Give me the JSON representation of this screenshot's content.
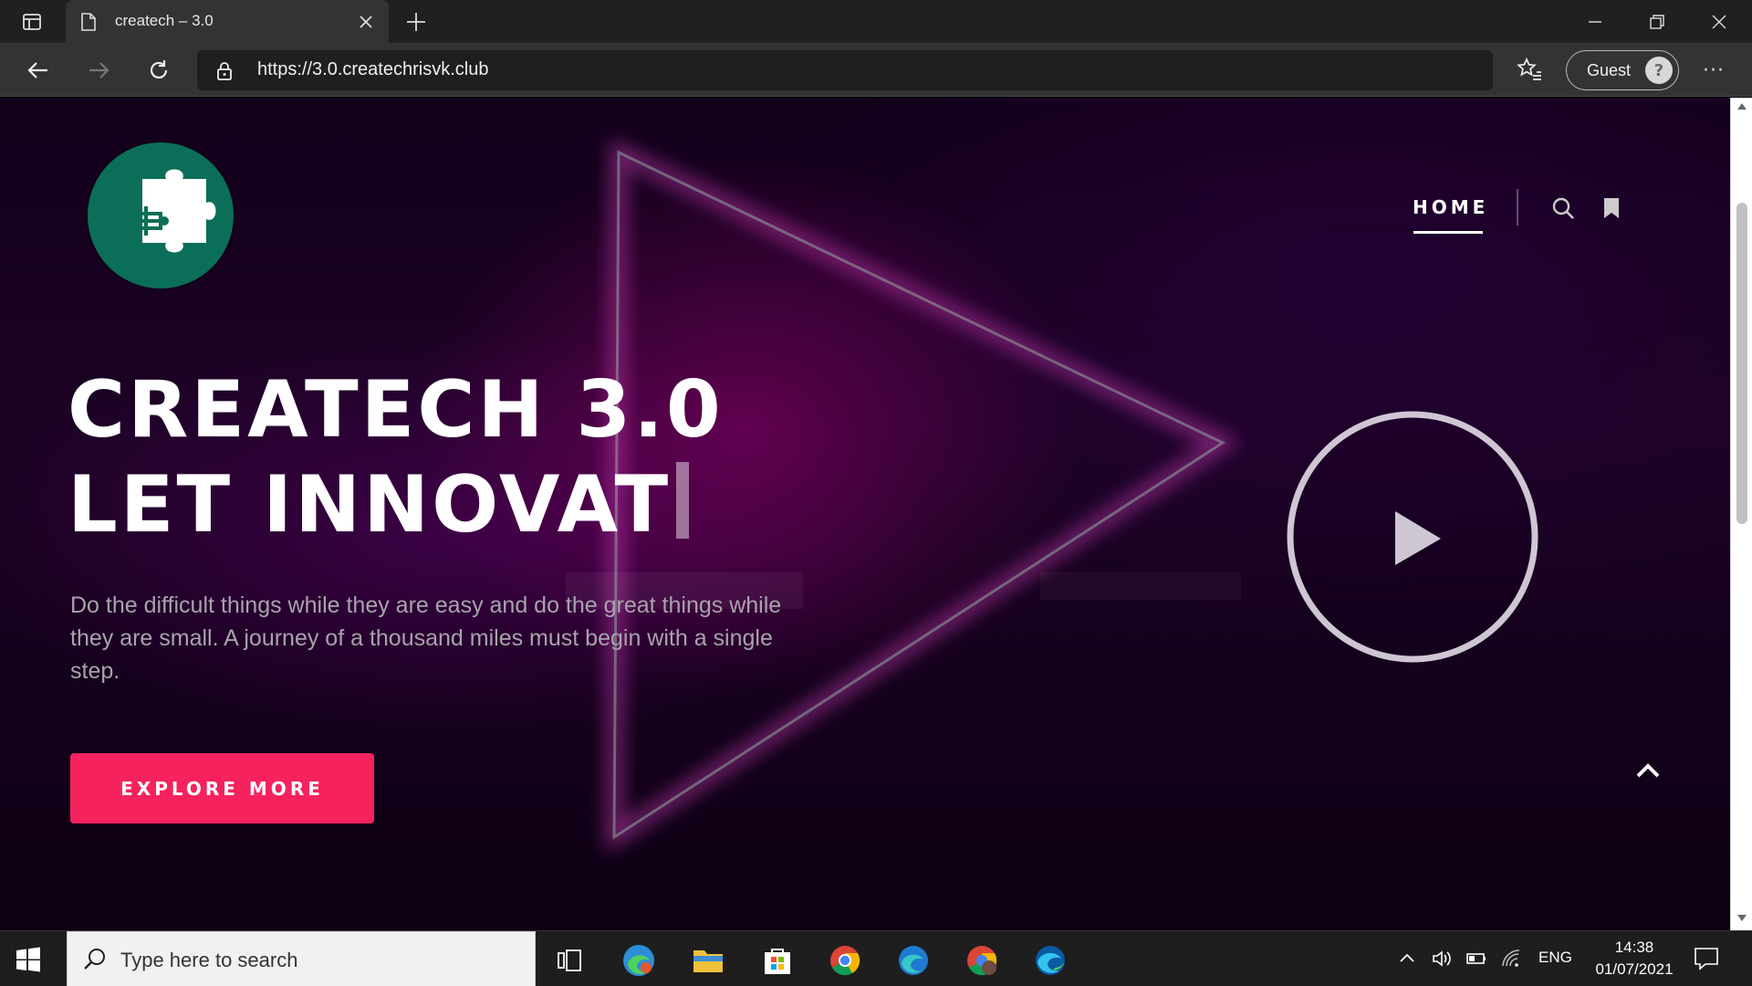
{
  "browser": {
    "tab_title": "createch – 3.0",
    "url": "https://3.0.createchrisvk.club",
    "profile_label": "Guest"
  },
  "site": {
    "nav": {
      "home": "HOME"
    },
    "headline_line1": "CREATECH 3.0",
    "headline_line2": "LET INNOVAT",
    "intro": "Do the difficult things while they are easy and do the great things while they are small. A journey of a thousand miles must begin with a single step.",
    "cta": "EXPLORE MORE"
  },
  "taskbar": {
    "search_placeholder": "Type here to search",
    "language": "ENG",
    "time": "14:38",
    "date": "01/07/2021"
  },
  "colors": {
    "accent": "#f5225e",
    "logo_bg": "#0b6e58",
    "browser_chrome": "#333333",
    "taskbar": "#1e1e1e"
  }
}
